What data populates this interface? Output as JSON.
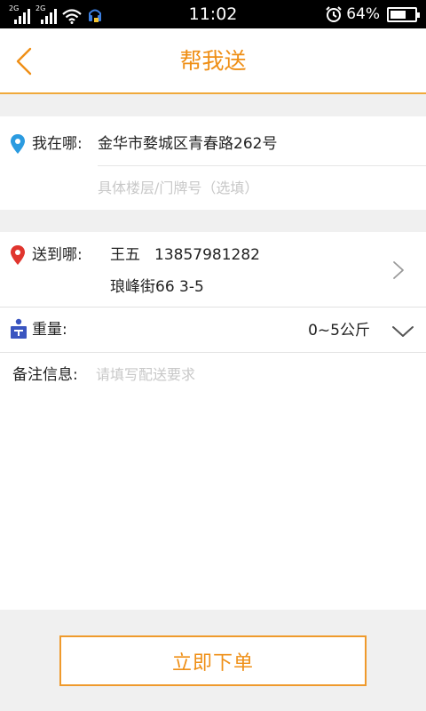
{
  "status_bar": {
    "sim1": "2G",
    "sim2": "2G",
    "time": "11:02",
    "battery": "64%",
    "battery_level": 0.64
  },
  "header": {
    "title": "帮我送"
  },
  "pickup": {
    "label": "我在哪:",
    "address": "金华市婺城区青春路262号",
    "detail_placeholder": "具体楼层/门牌号（选填）"
  },
  "delivery": {
    "label": "送到哪:",
    "contact_name": "王五",
    "contact_phone": "13857981282",
    "address": "琅峰街66 3-5"
  },
  "weight": {
    "label": "重量:",
    "value": "0~5公斤"
  },
  "remark": {
    "label": "备注信息:",
    "placeholder": "请填写配送要求"
  },
  "footer": {
    "submit_label": "立即下单"
  },
  "colors": {
    "accent": "#ef8f16",
    "pin_blue": "#2b9be0",
    "pin_red": "#e0352e",
    "weight_icon": "#3a55c0"
  }
}
